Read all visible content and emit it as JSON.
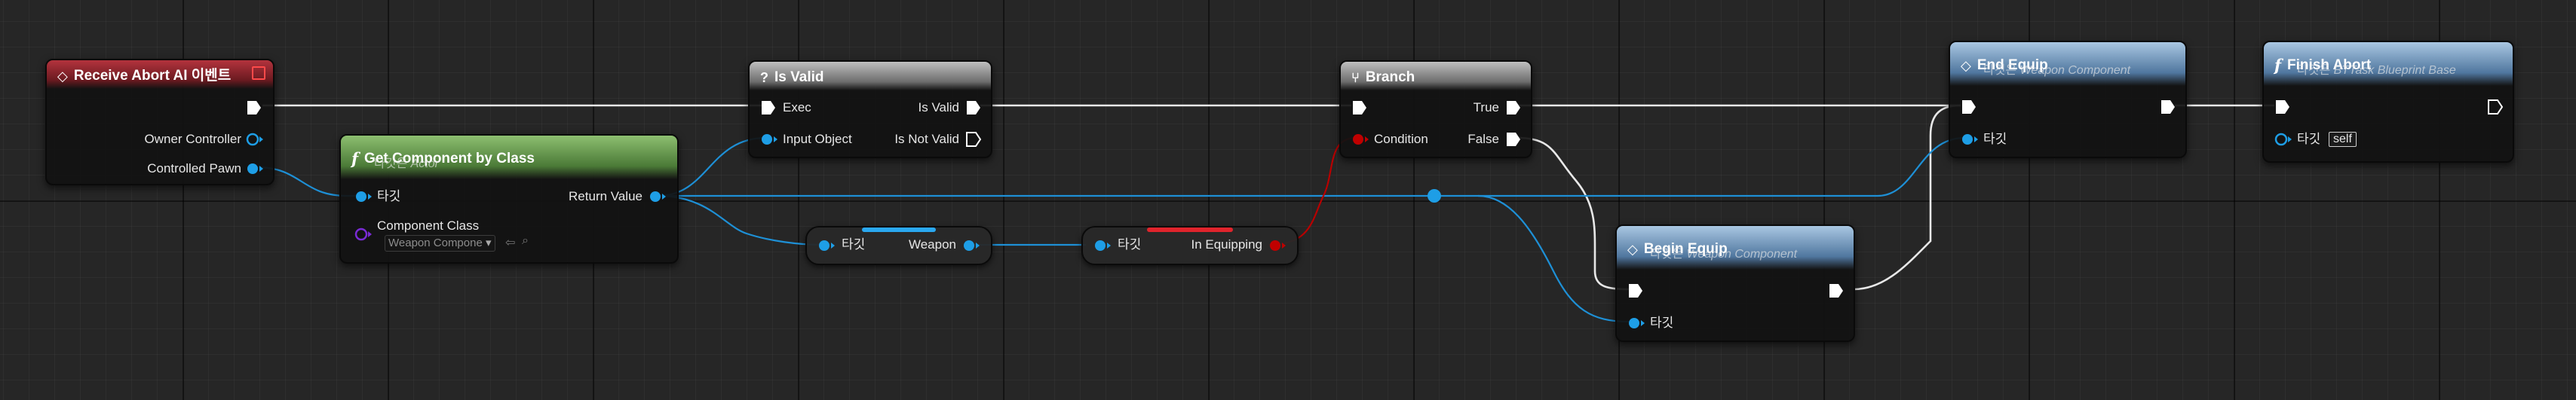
{
  "nodes": {
    "receive_abort": {
      "title": "Receive Abort AI 이벤트",
      "pins": {
        "owner_controller": "Owner Controller",
        "controlled_pawn": "Controlled Pawn"
      }
    },
    "get_component": {
      "title": "Get Component by Class",
      "subtitle_prefix": "타깃은 ",
      "subtitle_target": "Actor",
      "pins": {
        "target": "타깃",
        "return_value": "Return Value",
        "component_class": "Component Class"
      },
      "combo_value": "Weapon Compone"
    },
    "is_valid": {
      "title": "Is Valid",
      "pins": {
        "exec": "Exec",
        "is_valid": "Is Valid",
        "input_object": "Input Object",
        "is_not_valid": "Is Not Valid"
      }
    },
    "weapon_getter": {
      "target": "타깃",
      "label": "Weapon"
    },
    "in_equipping_getter": {
      "target": "타깃",
      "label": "In Equipping"
    },
    "branch": {
      "title": "Branch",
      "pins": {
        "true": "True",
        "condition": "Condition",
        "false": "False"
      }
    },
    "begin_equip": {
      "title": "Begin Equip",
      "subtitle_prefix": "타깃은 ",
      "subtitle_target": "Weapon Component",
      "pins": {
        "target": "타깃"
      }
    },
    "end_equip": {
      "title": "End Equip",
      "subtitle_prefix": "타깃은 ",
      "subtitle_target": "Weapon Component",
      "pins": {
        "target": "타깃"
      }
    },
    "finish_abort": {
      "title": "Finish Abort",
      "subtitle_prefix": "타깃은 ",
      "subtitle_target": "BTTask Blueprint Base",
      "pins": {
        "target": "타깃"
      },
      "self_value": "self"
    }
  },
  "colors": {
    "exec": "#ffffff",
    "object": "#1e9ee6",
    "class": "#7a2bd6",
    "bool": "#b80000",
    "event_header": "#b3333d",
    "function_header": "#50779f",
    "pure_header": "#4b7a37"
  },
  "icons": {
    "event": "diamond-event-icon",
    "function": "function-f-icon",
    "macro_valid": "question-icon",
    "branch": "branch-icon"
  }
}
